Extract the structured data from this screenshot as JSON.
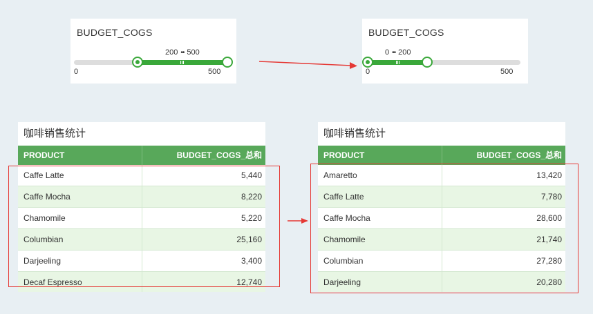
{
  "slider_before": {
    "title": "BUDGET_COGS",
    "range_low": "200",
    "range_sep": "••",
    "range_high": "500",
    "min_tick": "0",
    "max_tick": "500",
    "low_value": 200,
    "high_value": 500,
    "scale_max": 500
  },
  "slider_after": {
    "title": "BUDGET_COGS",
    "range_low": "0",
    "range_sep": "••",
    "range_high": "200",
    "min_tick": "0",
    "max_tick": "500",
    "low_value": 0,
    "high_value": 200,
    "scale_max": 500
  },
  "table_before": {
    "title": "咖啡销售统计",
    "col_product": "PRODUCT",
    "col_sum": "BUDGET_COGS_总和",
    "rows": [
      {
        "product": "Caffe Latte",
        "value": "5,440"
      },
      {
        "product": "Caffe Mocha",
        "value": "8,220"
      },
      {
        "product": "Chamomile",
        "value": "5,220"
      },
      {
        "product": "Columbian",
        "value": "25,160"
      },
      {
        "product": "Darjeeling",
        "value": "3,400"
      },
      {
        "product": "Decaf Espresso",
        "value": "12,740"
      }
    ]
  },
  "table_after": {
    "title": "咖啡销售统计",
    "col_product": "PRODUCT",
    "col_sum": "BUDGET_COGS_总和",
    "rows": [
      {
        "product": "Amaretto",
        "value": "13,420"
      },
      {
        "product": "Caffe Latte",
        "value": "7,780"
      },
      {
        "product": "Caffe Mocha",
        "value": "28,600"
      },
      {
        "product": "Chamomile",
        "value": "21,740"
      },
      {
        "product": "Columbian",
        "value": "27,280"
      },
      {
        "product": "Darjeeling",
        "value": "20,280"
      }
    ]
  },
  "colors": {
    "accent_green": "#3aa83a",
    "header_green": "#58a85a",
    "row_alt": "#e8f6e4",
    "annotation_red": "#e53935",
    "background": "#e8eff3"
  }
}
